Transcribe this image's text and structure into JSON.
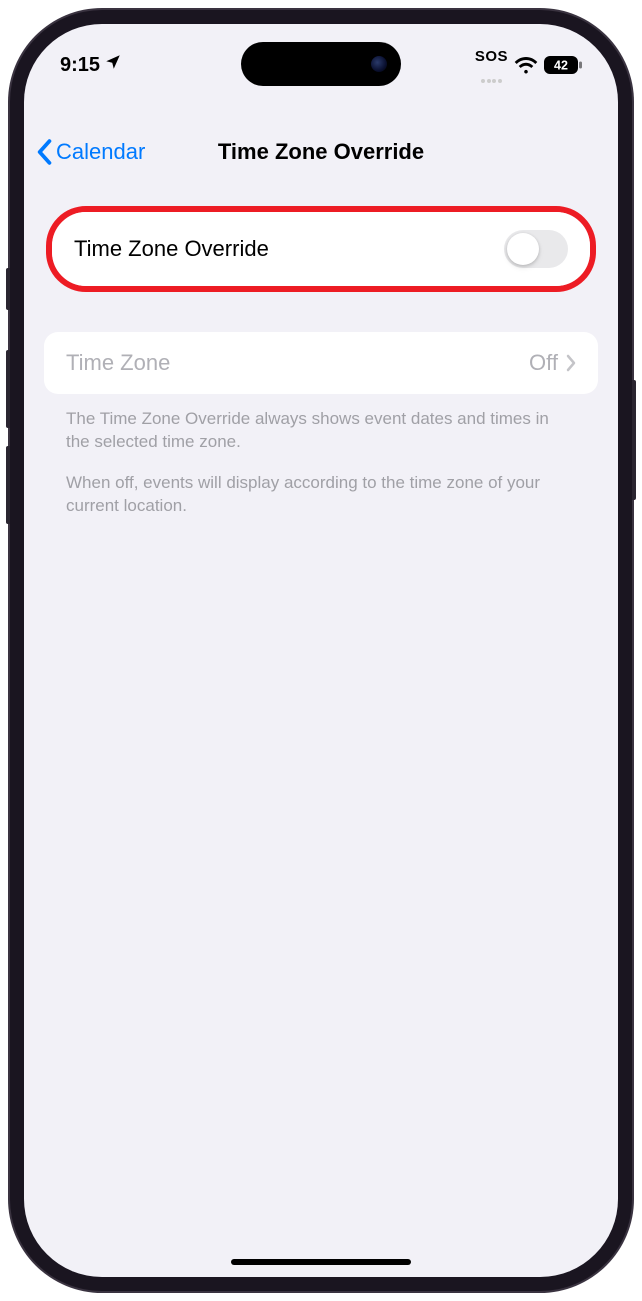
{
  "status": {
    "time": "9:15",
    "sos": "SOS",
    "battery": "42"
  },
  "nav": {
    "back_label": "Calendar",
    "title": "Time Zone Override"
  },
  "rows": {
    "override": {
      "label": "Time Zone Override"
    },
    "timezone": {
      "label": "Time Zone",
      "value": "Off"
    }
  },
  "footer": {
    "p1": "The Time Zone Override always shows event dates and times in the selected time zone.",
    "p2": "When off, events will display according to the time zone of your current location."
  }
}
